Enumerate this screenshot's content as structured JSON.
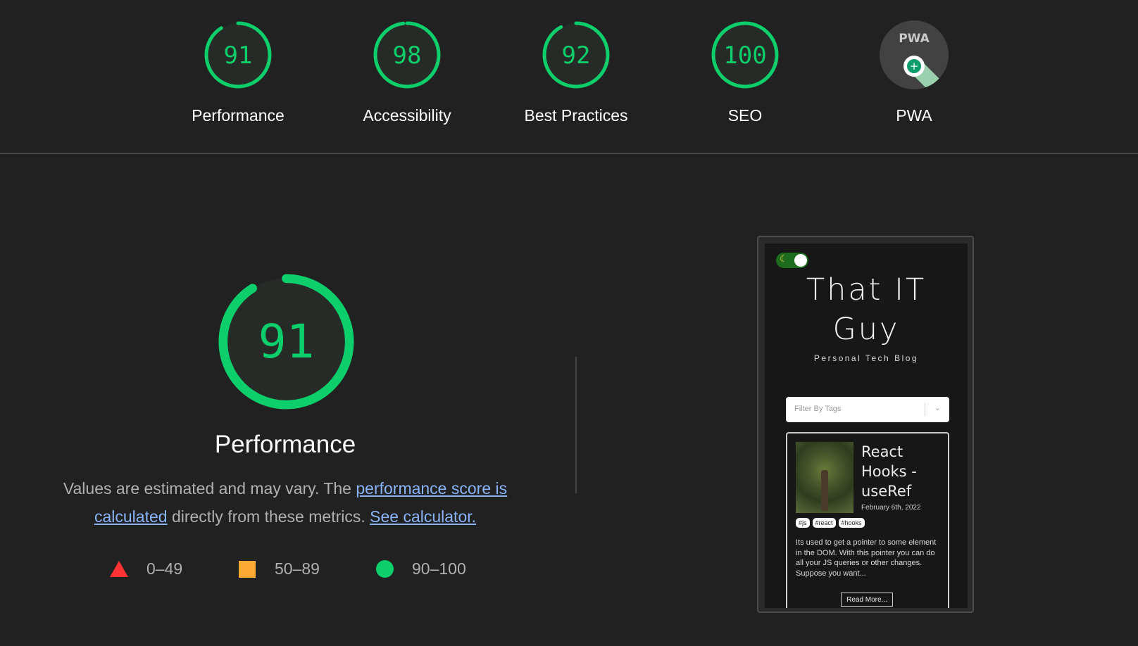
{
  "categories": [
    {
      "label": "Performance",
      "score": "91",
      "fraction": 0.91
    },
    {
      "label": "Accessibility",
      "score": "98",
      "fraction": 0.98
    },
    {
      "label": "Best Practices",
      "score": "92",
      "fraction": 0.92
    },
    {
      "label": "SEO",
      "score": "100",
      "fraction": 1.0
    },
    {
      "label": "PWA",
      "badge_text": "PWA"
    }
  ],
  "main": {
    "score": "91",
    "fraction": 0.91,
    "title": "Performance",
    "desc_prefix": "Values are estimated and may vary. The ",
    "desc_link1": "performance score is calculated",
    "desc_middle": " directly from these metrics. ",
    "desc_link2": "See calculator."
  },
  "legend": [
    {
      "range": "0–49",
      "shape": "triangle",
      "color": "#ff3333"
    },
    {
      "range": "50–89",
      "shape": "square",
      "color": "#ffaa33"
    },
    {
      "range": "90–100",
      "shape": "circle",
      "color": "#0cce6b"
    }
  ],
  "colors": {
    "pass": "#0cce6b",
    "background": "#212121"
  },
  "screenshot": {
    "site_title_line1": "That IT",
    "site_title_line2": "Guy",
    "site_subtitle": "Personal Tech Blog",
    "filter_placeholder": "Filter By Tags",
    "post": {
      "title": "React Hooks - useRef",
      "date": "February 6th, 2022",
      "tags": [
        "#js",
        "#react",
        "#hooks"
      ],
      "excerpt": "Its used to get a pointer to some element in the DOM. With this pointer you can do all your JS queries or other changes. Suppose you want...",
      "read_more": "Read More..."
    }
  }
}
